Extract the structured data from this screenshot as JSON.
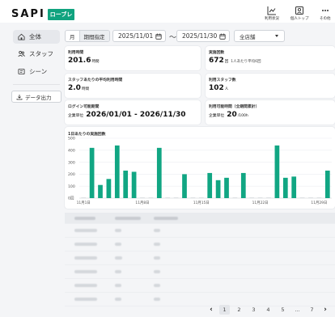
{
  "header": {
    "logo": "SAPI",
    "badge": "ローブレ",
    "nav": [
      {
        "label": "利用状況",
        "icon": "chart-icon"
      },
      {
        "label": "個人トップ",
        "icon": "person-icon"
      },
      {
        "label": "その他",
        "icon": "more-icon"
      }
    ]
  },
  "sidebar": {
    "items": [
      {
        "label": "全体",
        "icon": "grid-icon",
        "active": true
      },
      {
        "label": "スタッフ",
        "icon": "staff-icon",
        "active": false
      },
      {
        "label": "シーン",
        "icon": "scene-icon",
        "active": false
      }
    ],
    "export_label": "データ出力"
  },
  "filters": {
    "month": "月",
    "period": "期間指定",
    "start_date": "2025/11/01",
    "end_date": "2025/11/30",
    "tilde": "〜",
    "store": "全店舗"
  },
  "stats": {
    "usage_time": {
      "label": "利用時間",
      "value": "201.6",
      "unit": "時間"
    },
    "sessions": {
      "label": "実施回数",
      "value": "672",
      "unit": "回",
      "sub": "1人あたり平均6回"
    },
    "avg_time": {
      "label": "スタッフあたりの平均利用時間",
      "value": "2.0",
      "unit": "時間"
    },
    "staff_count": {
      "label": "利用スタッフ数",
      "value": "102",
      "unit": "人"
    },
    "login_period": {
      "label": "ログイン可能期間",
      "prefix": "企業単位",
      "value": "2026/01/01 - 2026/11/30"
    },
    "usable_time": {
      "label": "利用可能時間（全期間累計）",
      "prefix": "企業単位",
      "value": "20",
      "unit": "/100h"
    }
  },
  "chart_data": {
    "type": "bar",
    "title": "1日あたりの実施回数",
    "ylim": [
      0,
      500
    ],
    "yticks": [
      0,
      100,
      200,
      300,
      400,
      500
    ],
    "ytick_labels": [
      "0回",
      "100",
      "200",
      "300",
      "400",
      "500"
    ],
    "categories": [
      "11/01",
      "11/02",
      "11/03",
      "11/04",
      "11/05",
      "11/06",
      "11/07",
      "11/08",
      "11/09",
      "11/10",
      "11/11",
      "11/12",
      "11/13",
      "11/14",
      "11/15",
      "11/16",
      "11/17",
      "11/18",
      "11/19",
      "11/20",
      "11/21",
      "11/22",
      "11/23",
      "11/24",
      "11/25",
      "11/26",
      "11/27",
      "11/28",
      "11/29",
      "11/30"
    ],
    "x_tick_labels": {
      "0": "11月1日",
      "7": "11月8日",
      "14": "11月15日",
      "21": "11月22日",
      "28": "11月29日"
    },
    "values": [
      0,
      420,
      110,
      160,
      440,
      230,
      220,
      0,
      0,
      420,
      0,
      0,
      200,
      0,
      0,
      210,
      150,
      170,
      0,
      210,
      0,
      0,
      0,
      440,
      170,
      180,
      0,
      0,
      0,
      230
    ],
    "bar_color": "#11a683",
    "grid": true
  },
  "table": {
    "columns": 3,
    "rows": 6
  },
  "pagination": {
    "prev": "‹",
    "next": "›",
    "pages": [
      "1",
      "2",
      "3",
      "4",
      "5",
      "…",
      "7"
    ],
    "current": "1"
  }
}
